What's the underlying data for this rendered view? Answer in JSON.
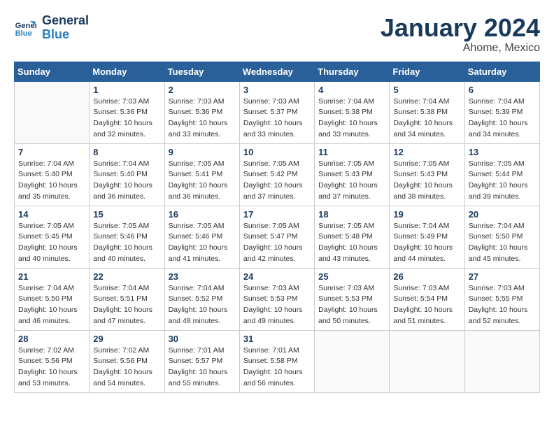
{
  "header": {
    "logo_general": "General",
    "logo_blue": "Blue",
    "month_title": "January 2024",
    "location": "Ahome, Mexico"
  },
  "days_of_week": [
    "Sunday",
    "Monday",
    "Tuesday",
    "Wednesday",
    "Thursday",
    "Friday",
    "Saturday"
  ],
  "weeks": [
    [
      {
        "day": "",
        "info": ""
      },
      {
        "day": "1",
        "info": "Sunrise: 7:03 AM\nSunset: 5:36 PM\nDaylight: 10 hours\nand 32 minutes."
      },
      {
        "day": "2",
        "info": "Sunrise: 7:03 AM\nSunset: 5:36 PM\nDaylight: 10 hours\nand 33 minutes."
      },
      {
        "day": "3",
        "info": "Sunrise: 7:03 AM\nSunset: 5:37 PM\nDaylight: 10 hours\nand 33 minutes."
      },
      {
        "day": "4",
        "info": "Sunrise: 7:04 AM\nSunset: 5:38 PM\nDaylight: 10 hours\nand 33 minutes."
      },
      {
        "day": "5",
        "info": "Sunrise: 7:04 AM\nSunset: 5:38 PM\nDaylight: 10 hours\nand 34 minutes."
      },
      {
        "day": "6",
        "info": "Sunrise: 7:04 AM\nSunset: 5:39 PM\nDaylight: 10 hours\nand 34 minutes."
      }
    ],
    [
      {
        "day": "7",
        "info": "Sunrise: 7:04 AM\nSunset: 5:40 PM\nDaylight: 10 hours\nand 35 minutes."
      },
      {
        "day": "8",
        "info": "Sunrise: 7:04 AM\nSunset: 5:40 PM\nDaylight: 10 hours\nand 36 minutes."
      },
      {
        "day": "9",
        "info": "Sunrise: 7:05 AM\nSunset: 5:41 PM\nDaylight: 10 hours\nand 36 minutes."
      },
      {
        "day": "10",
        "info": "Sunrise: 7:05 AM\nSunset: 5:42 PM\nDaylight: 10 hours\nand 37 minutes."
      },
      {
        "day": "11",
        "info": "Sunrise: 7:05 AM\nSunset: 5:43 PM\nDaylight: 10 hours\nand 37 minutes."
      },
      {
        "day": "12",
        "info": "Sunrise: 7:05 AM\nSunset: 5:43 PM\nDaylight: 10 hours\nand 38 minutes."
      },
      {
        "day": "13",
        "info": "Sunrise: 7:05 AM\nSunset: 5:44 PM\nDaylight: 10 hours\nand 39 minutes."
      }
    ],
    [
      {
        "day": "14",
        "info": "Sunrise: 7:05 AM\nSunset: 5:45 PM\nDaylight: 10 hours\nand 40 minutes."
      },
      {
        "day": "15",
        "info": "Sunrise: 7:05 AM\nSunset: 5:46 PM\nDaylight: 10 hours\nand 40 minutes."
      },
      {
        "day": "16",
        "info": "Sunrise: 7:05 AM\nSunset: 5:46 PM\nDaylight: 10 hours\nand 41 minutes."
      },
      {
        "day": "17",
        "info": "Sunrise: 7:05 AM\nSunset: 5:47 PM\nDaylight: 10 hours\nand 42 minutes."
      },
      {
        "day": "18",
        "info": "Sunrise: 7:05 AM\nSunset: 5:48 PM\nDaylight: 10 hours\nand 43 minutes."
      },
      {
        "day": "19",
        "info": "Sunrise: 7:04 AM\nSunset: 5:49 PM\nDaylight: 10 hours\nand 44 minutes."
      },
      {
        "day": "20",
        "info": "Sunrise: 7:04 AM\nSunset: 5:50 PM\nDaylight: 10 hours\nand 45 minutes."
      }
    ],
    [
      {
        "day": "21",
        "info": "Sunrise: 7:04 AM\nSunset: 5:50 PM\nDaylight: 10 hours\nand 46 minutes."
      },
      {
        "day": "22",
        "info": "Sunrise: 7:04 AM\nSunset: 5:51 PM\nDaylight: 10 hours\nand 47 minutes."
      },
      {
        "day": "23",
        "info": "Sunrise: 7:04 AM\nSunset: 5:52 PM\nDaylight: 10 hours\nand 48 minutes."
      },
      {
        "day": "24",
        "info": "Sunrise: 7:03 AM\nSunset: 5:53 PM\nDaylight: 10 hours\nand 49 minutes."
      },
      {
        "day": "25",
        "info": "Sunrise: 7:03 AM\nSunset: 5:53 PM\nDaylight: 10 hours\nand 50 minutes."
      },
      {
        "day": "26",
        "info": "Sunrise: 7:03 AM\nSunset: 5:54 PM\nDaylight: 10 hours\nand 51 minutes."
      },
      {
        "day": "27",
        "info": "Sunrise: 7:03 AM\nSunset: 5:55 PM\nDaylight: 10 hours\nand 52 minutes."
      }
    ],
    [
      {
        "day": "28",
        "info": "Sunrise: 7:02 AM\nSunset: 5:56 PM\nDaylight: 10 hours\nand 53 minutes."
      },
      {
        "day": "29",
        "info": "Sunrise: 7:02 AM\nSunset: 5:56 PM\nDaylight: 10 hours\nand 54 minutes."
      },
      {
        "day": "30",
        "info": "Sunrise: 7:01 AM\nSunset: 5:57 PM\nDaylight: 10 hours\nand 55 minutes."
      },
      {
        "day": "31",
        "info": "Sunrise: 7:01 AM\nSunset: 5:58 PM\nDaylight: 10 hours\nand 56 minutes."
      },
      {
        "day": "",
        "info": ""
      },
      {
        "day": "",
        "info": ""
      },
      {
        "day": "",
        "info": ""
      }
    ]
  ]
}
